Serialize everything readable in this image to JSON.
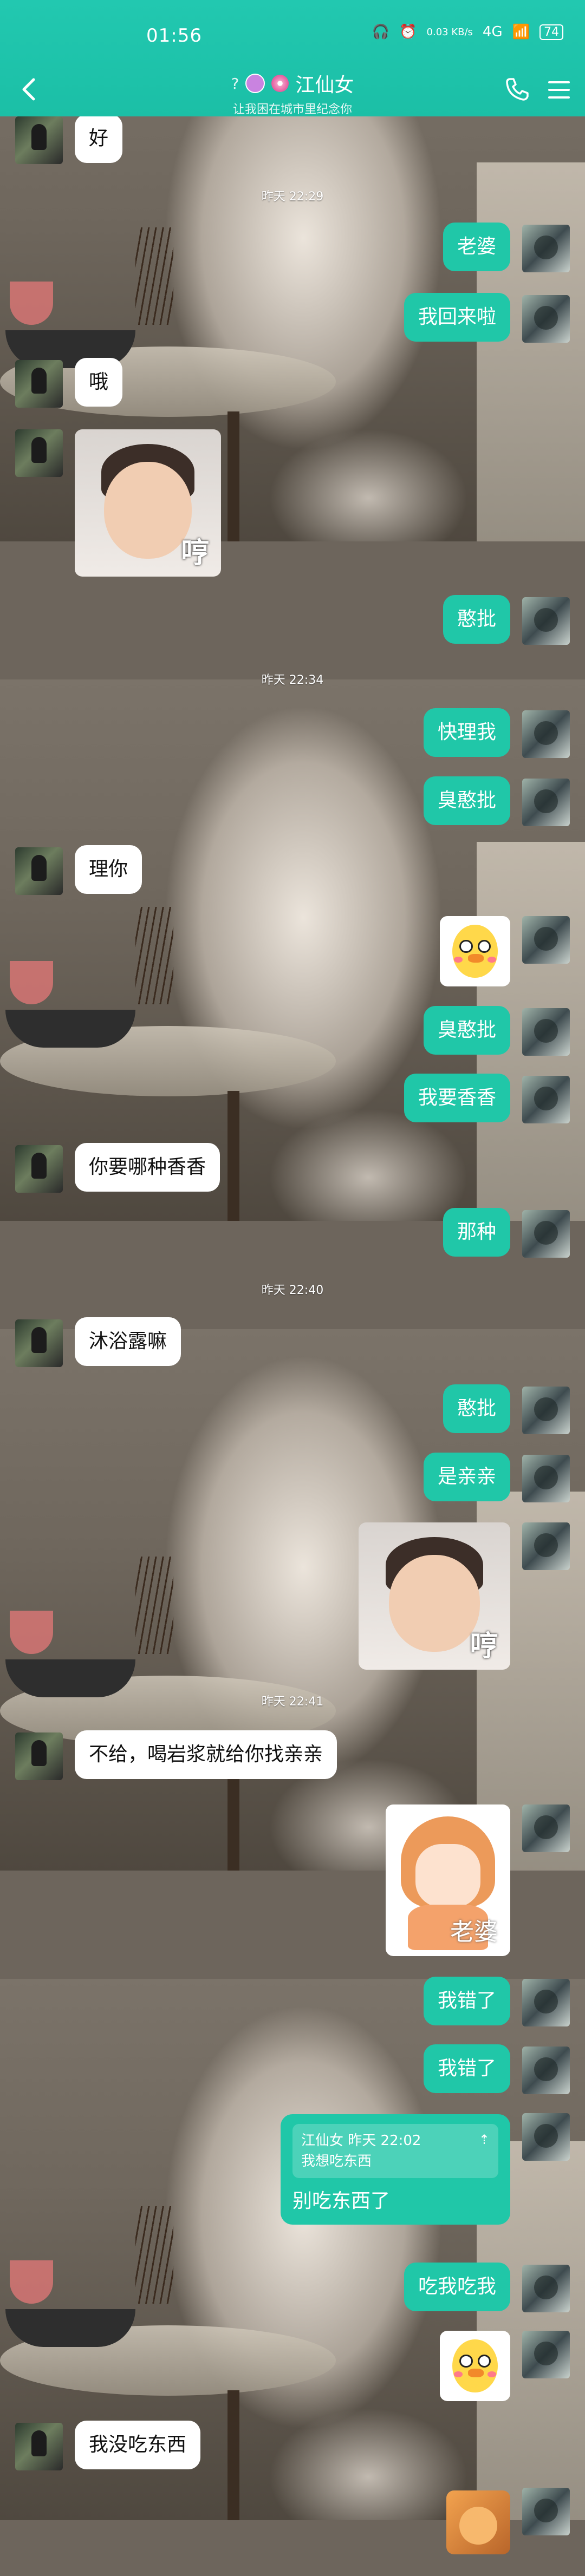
{
  "status_bar": {
    "time": "01:56",
    "network": "0.03 KB/s",
    "signal": "4G",
    "battery": "74"
  },
  "header": {
    "title": "江仙女",
    "subtitle": "让我困在城市里纪念你"
  },
  "icons": [
    "back-arrow-icon",
    "question-icon",
    "face-icon",
    "flower-icon",
    "phone-icon",
    "menu-icon"
  ],
  "colors": {
    "header": "#1bbfa6",
    "my_bubble": "#20c7a8",
    "their_bubble": "#ffffff"
  },
  "messages": [
    {
      "kind": "text",
      "side": "left",
      "text": "好"
    },
    {
      "kind": "time",
      "text": "昨天 22:29"
    },
    {
      "kind": "text",
      "side": "right",
      "text": "老婆"
    },
    {
      "kind": "text",
      "side": "right",
      "text": "我回来啦"
    },
    {
      "kind": "text",
      "side": "left",
      "text": "哦"
    },
    {
      "kind": "sticker",
      "side": "left",
      "sticker": "baby-pout",
      "caption": "哼"
    },
    {
      "kind": "text",
      "side": "right",
      "text": "憨批"
    },
    {
      "kind": "time",
      "text": "昨天 22:34"
    },
    {
      "kind": "text",
      "side": "right",
      "text": "快理我"
    },
    {
      "kind": "text",
      "side": "right",
      "text": "臭憨批"
    },
    {
      "kind": "text",
      "side": "left",
      "text": "理你"
    },
    {
      "kind": "sticker",
      "side": "right",
      "sticker": "duck"
    },
    {
      "kind": "text",
      "side": "right",
      "text": "臭憨批"
    },
    {
      "kind": "text",
      "side": "right",
      "text": "我要香香"
    },
    {
      "kind": "text",
      "side": "left",
      "text": "你要哪种香香"
    },
    {
      "kind": "text",
      "side": "right",
      "text": "那种"
    },
    {
      "kind": "time",
      "text": "昨天 22:40"
    },
    {
      "kind": "text",
      "side": "left",
      "text": "沐浴露嘛"
    },
    {
      "kind": "text",
      "side": "right",
      "text": "憨批"
    },
    {
      "kind": "text",
      "side": "right",
      "text": "是亲亲"
    },
    {
      "kind": "sticker",
      "side": "right",
      "sticker": "baby-pout",
      "caption": "哼"
    },
    {
      "kind": "time",
      "text": "昨天 22:41"
    },
    {
      "kind": "text",
      "side": "left",
      "text": "不给，喝岩浆就给你找亲亲"
    },
    {
      "kind": "sticker",
      "side": "right",
      "sticker": "anime-crying",
      "caption": "老婆"
    },
    {
      "kind": "text",
      "side": "right",
      "text": "我错了"
    },
    {
      "kind": "text",
      "side": "right",
      "text": "我错了"
    },
    {
      "kind": "quote",
      "side": "right",
      "quote_header": "江仙女 昨天 22:02",
      "quote_text": "我想吃东西",
      "text": "别吃东西了"
    },
    {
      "kind": "text",
      "side": "right",
      "text": "吃我吃我"
    },
    {
      "kind": "sticker",
      "side": "right",
      "sticker": "duck"
    },
    {
      "kind": "text",
      "side": "left",
      "text": "我没吃东西"
    },
    {
      "kind": "sticker",
      "side": "right",
      "sticker": "cat"
    }
  ]
}
